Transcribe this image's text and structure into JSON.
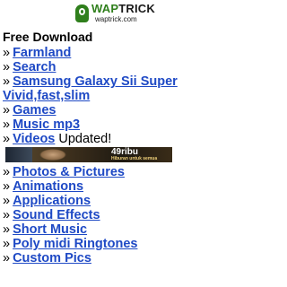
{
  "brand": {
    "logo_text_green": "WAP",
    "logo_text_dark": "TRICK",
    "domain": "waptrick.com"
  },
  "section_title": "Free Download",
  "bullet": "»",
  "menu_top": [
    {
      "label": "Farmland"
    },
    {
      "label": "Search"
    },
    {
      "label": "Samsung Galaxy Sii Super Vivid,fast,slim"
    },
    {
      "label": "Games"
    },
    {
      "label": "Music mp3"
    },
    {
      "label": "Videos",
      "suffix": "Updated!"
    }
  ],
  "banner": {
    "headline": "49ribu",
    "subtext": "Hiburan untuk semua"
  },
  "menu_bottom": [
    {
      "label": "Photos & Pictures"
    },
    {
      "label": "Animations"
    },
    {
      "label": "Applications"
    },
    {
      "label": "Sound Effects"
    },
    {
      "label": "Short Music"
    },
    {
      "label": "Poly midi Ringtones"
    },
    {
      "label": "Custom Pics"
    }
  ]
}
